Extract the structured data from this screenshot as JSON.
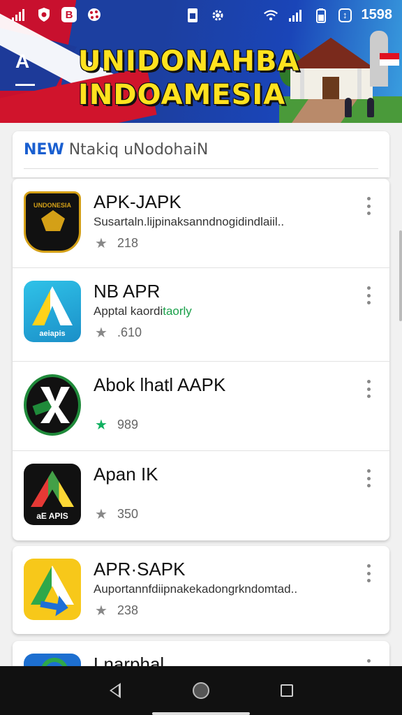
{
  "status_bar": {
    "time": "1598",
    "battery_label": "↕",
    "icons": [
      "signal-icon",
      "shield-icon",
      "app-icon",
      "settings-icon",
      "wifi-icon",
      "battery-icon"
    ]
  },
  "header": {
    "logo_text": "A—",
    "title_line1": "UNIDONAHBA",
    "title_line2": "INDOAMESIA"
  },
  "section": {
    "new_label": "NEW",
    "title": "Ntakiq uNodohaiN"
  },
  "apps": [
    {
      "name": "APK-JAPK",
      "description": "Susartaln.lijpinaksanndnogidindlaiil..",
      "rating": "218",
      "icon_text": "UNDONESIA"
    },
    {
      "name": "NB APR",
      "description": "Apptal kaordi",
      "description_accent": "taorly",
      "rating": ".610",
      "icon_text": "aeiapis"
    },
    {
      "name": "Abok lhatl AAPK",
      "description": "",
      "rating": "989",
      "icon_text": ""
    },
    {
      "name": "Apan IK",
      "description": "",
      "rating": "350",
      "icon_text": "aE APIS"
    },
    {
      "name": "APR·SAPK",
      "description": "Auportannfdiipnakekadongrkndomtad..",
      "rating": "238",
      "icon_text": ""
    },
    {
      "name": "Lnarphal",
      "description": "",
      "rating": "",
      "icon_text": ""
    }
  ],
  "colors": {
    "accent_blue": "#1a5fd0",
    "brand_red": "#c8102e",
    "banner_blue": "#1c3fa0",
    "title_yellow": "#ffe21f",
    "rating_green": "#10b060"
  }
}
